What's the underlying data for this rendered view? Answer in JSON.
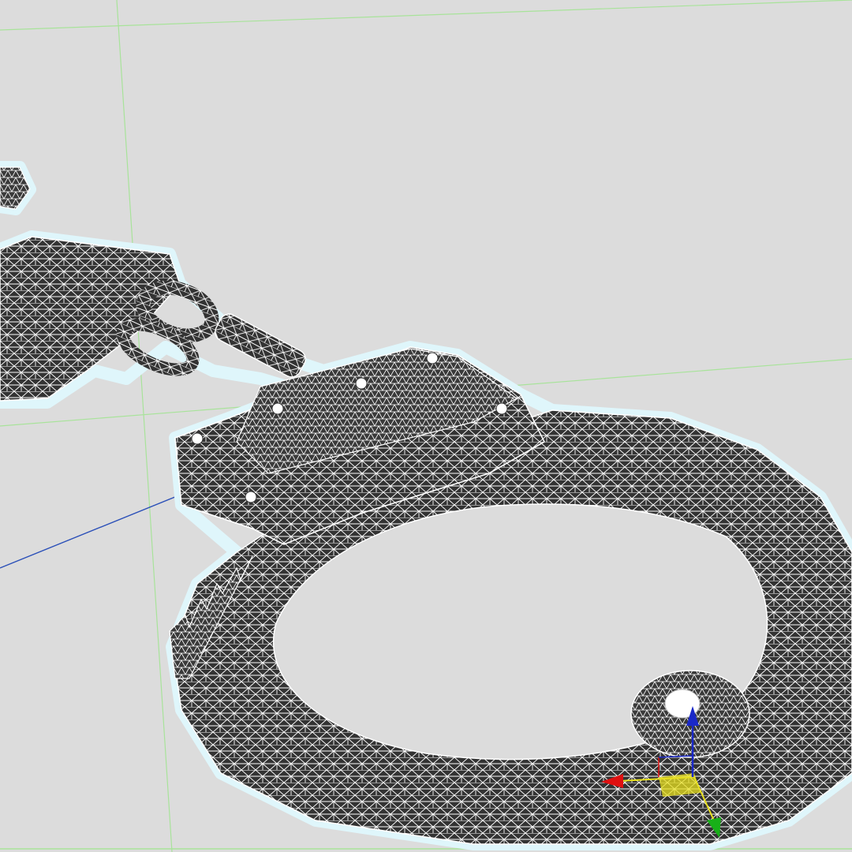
{
  "viewport": {
    "background": "#dcdcdc",
    "grid_color": "#a8e39a",
    "world_axis_color": "#2a4fb8",
    "selection_halo_color": "#dff6fb",
    "mesh_fill": "#333333",
    "wire_color": "#ffffff",
    "shading_mode": "wireframe-on-shaded",
    "selected_object": "handcuffs"
  },
  "gizmo": {
    "type": "transform-gizmo",
    "x_axis_color": "#e01010",
    "y_axis_color": "#18b018",
    "z_axis_color": "#1a28c8",
    "plane_color": "#e8e020"
  }
}
